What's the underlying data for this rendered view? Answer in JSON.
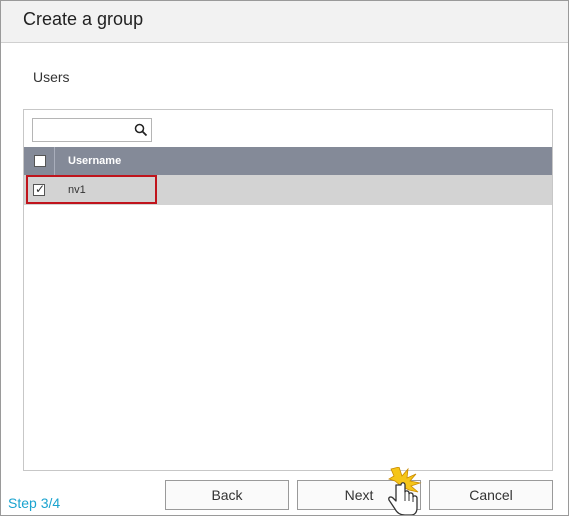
{
  "dialog": {
    "title": "Create a group",
    "section_label": "Users"
  },
  "search": {
    "value": "",
    "placeholder": "",
    "icon": "search-icon"
  },
  "table": {
    "columns": [
      "Username"
    ],
    "header_checked": false,
    "rows": [
      {
        "username": "nv1",
        "checked": true,
        "selected": true
      }
    ],
    "header_color": "#848a98",
    "selected_row_color": "#d3d3d3"
  },
  "footer": {
    "step": "Step 3/4",
    "step_color": "#1aa3cf",
    "back_label": "Back",
    "next_label": "Next",
    "cancel_label": "Cancel"
  },
  "annotation": {
    "highlight_color": "#c0141c",
    "cursor_icon": "hand-pointer-click-icon"
  }
}
